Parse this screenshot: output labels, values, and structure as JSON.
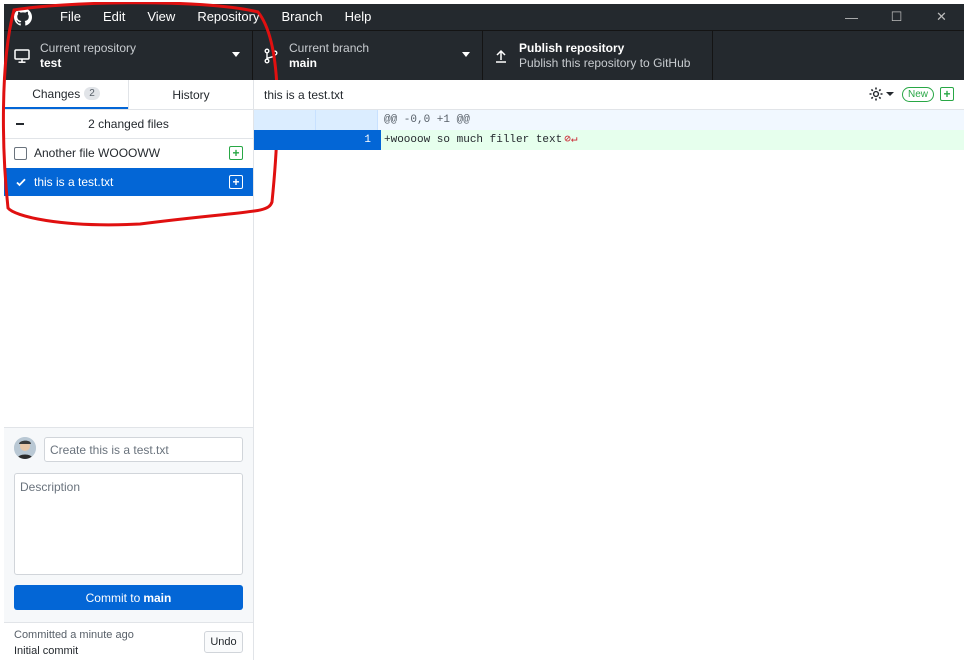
{
  "menu": {
    "items": [
      "File",
      "Edit",
      "View",
      "Repository",
      "Branch",
      "Help"
    ]
  },
  "window_controls": {
    "minimize": "—",
    "maximize": "☐",
    "close": "✕"
  },
  "toolbar": {
    "repository": {
      "label": "Current repository",
      "value": "test"
    },
    "branch": {
      "label": "Current branch",
      "value": "main"
    },
    "publish": {
      "label": "Publish repository",
      "value": "Publish this repository to GitHub"
    }
  },
  "sidebar": {
    "tabs": [
      {
        "label": "Changes",
        "count": "2"
      },
      {
        "label": "History"
      }
    ],
    "changed_files_label": "2 changed files",
    "files": [
      {
        "name": "Another file WOOOWW",
        "checked": false,
        "status": "added"
      },
      {
        "name": "this is a test.txt",
        "checked": true,
        "status": "added",
        "selected": true
      }
    ]
  },
  "commit": {
    "summary_placeholder": "Create this is a test.txt",
    "description_placeholder": "Description",
    "button_prefix": "Commit to",
    "button_branch": "main"
  },
  "last_commit": {
    "time": "Committed a minute ago",
    "message": "Initial commit",
    "undo_label": "Undo"
  },
  "diff": {
    "file_path": "this is a test.txt",
    "new_badge": "New",
    "hunk_header": "@@ -0,0 +1 @@",
    "lines": [
      {
        "old": "",
        "new": "1",
        "text": "+woooow so much filler text"
      }
    ]
  },
  "colors": {
    "titlebar": "#24292e",
    "accent": "#0366d6",
    "added": "#28a745"
  }
}
